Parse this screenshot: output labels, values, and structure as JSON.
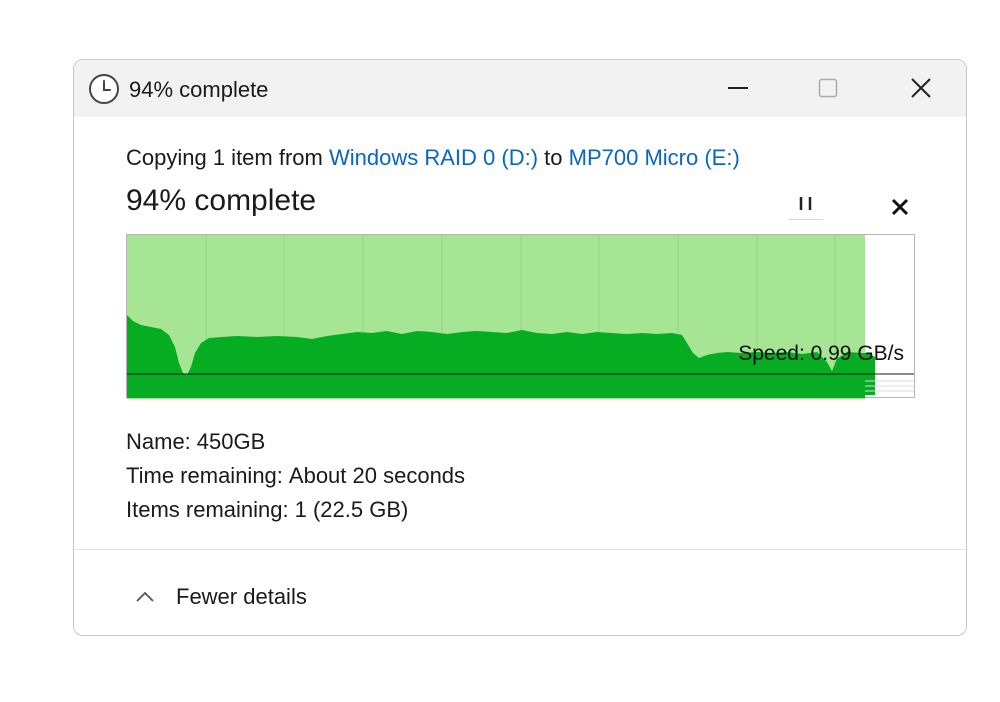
{
  "window": {
    "title": "94% complete",
    "icon": "clock-icon",
    "controls": [
      "minimize-icon",
      "maximize-icon",
      "close-icon"
    ]
  },
  "copy": {
    "prefix": "Copying 1 item from",
    "source": "Windows RAID 0 (D:)",
    "middle": "to",
    "destination": "MP700 Micro (E:)",
    "percent_label": "94% complete",
    "progress_fraction": 0.94
  },
  "actions": {
    "pause_icon": "pause-icon",
    "cancel_icon": "cancel-icon"
  },
  "graph": {
    "speed_label": "Speed: 0.99 GB/s",
    "colors": {
      "progress_fill": "#a6e593",
      "speed_fill": "#06ad23",
      "grid": "#93d67f",
      "average_line": "#1a1a1a"
    }
  },
  "details": {
    "name_label": "Name:",
    "name_value": "450GB",
    "time_label": "Time remaining:",
    "time_value": "About 20 seconds",
    "items_label": "Items remaining:",
    "items_value": "1 (22.5 GB)"
  },
  "footer": {
    "toggle_label": "Fewer details",
    "toggle_icon": "chevron-up-icon"
  },
  "accent": "#0a66c2"
}
